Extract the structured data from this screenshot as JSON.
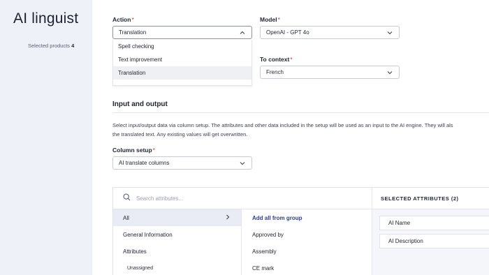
{
  "sidebar": {
    "title": "AI linguist",
    "selected_label": "Selected products",
    "selected_count": "4"
  },
  "form": {
    "action": {
      "label": "Action",
      "value": "Translation",
      "options": [
        "Spell checking",
        "Text improvement",
        "Translation"
      ],
      "highlighted_option": "Translation"
    },
    "model": {
      "label": "Model",
      "value": "OpenAI - GPT 4o"
    },
    "to_context": {
      "label": "To context",
      "value": "French"
    },
    "required_marker": "*"
  },
  "input_output": {
    "title": "Input and output",
    "description_line1": "Select input/output data via column setup. The attributes and other data included in the setup will be used as an input to the AI engine. They will als",
    "description_line2": "the translated text. Any existing values will get overwritten.",
    "column_setup": {
      "label": "Column setup",
      "value": "AI translate columns"
    }
  },
  "attribute_picker": {
    "search_placeholder": "Search attributes...",
    "groups": [
      "All",
      "General Information",
      "Attributes",
      "Unassigned"
    ],
    "active_group": "All",
    "attributes": [
      "Add all from group",
      "Approved by",
      "Assembly",
      "CE mark"
    ],
    "selected_header": "SELECTED ATTRIBUTES (2)",
    "selected": [
      "AI Name",
      "AI Description"
    ]
  },
  "colors": {
    "sidebar_bg": "#eef1f8",
    "link": "#2a3f8f",
    "required": "#c0392b"
  }
}
